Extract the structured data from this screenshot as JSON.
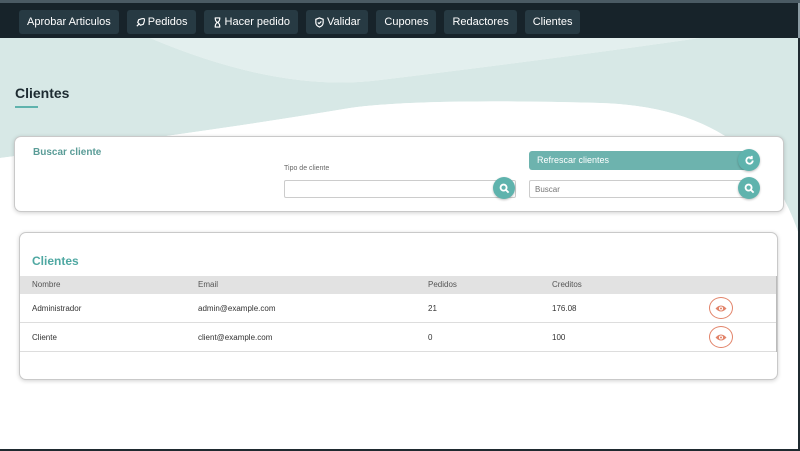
{
  "nav": {
    "items": [
      {
        "label": "Aprobar Articulos",
        "icon": "none"
      },
      {
        "label": "Pedidos",
        "icon": "rocket-icon"
      },
      {
        "label": "Hacer pedido",
        "icon": "hourglass-icon"
      },
      {
        "label": "Validar",
        "icon": "shield-icon"
      },
      {
        "label": "Cupones",
        "icon": "none"
      },
      {
        "label": "Redactores",
        "icon": "none"
      },
      {
        "label": "Clientes",
        "icon": "none"
      }
    ]
  },
  "page": {
    "title": "Clientes"
  },
  "search": {
    "title": "Buscar cliente",
    "type_label": "Tipo de cliente",
    "type_value": "",
    "refresh_label": "Refrescar clientes",
    "buscar_placeholder": "Buscar"
  },
  "table": {
    "title": "Clientes",
    "headers": [
      "Nombre",
      "Email",
      "Pedidos",
      "Creditos"
    ],
    "rows": [
      {
        "nombre": "Administrador",
        "email": "admin@example.com",
        "pedidos": "21",
        "creditos": "176.08"
      },
      {
        "nombre": "Cliente",
        "email": "client@example.com",
        "pedidos": "0",
        "creditos": "100"
      }
    ]
  },
  "colors": {
    "accent": "#5fb3ad",
    "nav_bg": "#17232a",
    "eye": "#e2846a"
  }
}
